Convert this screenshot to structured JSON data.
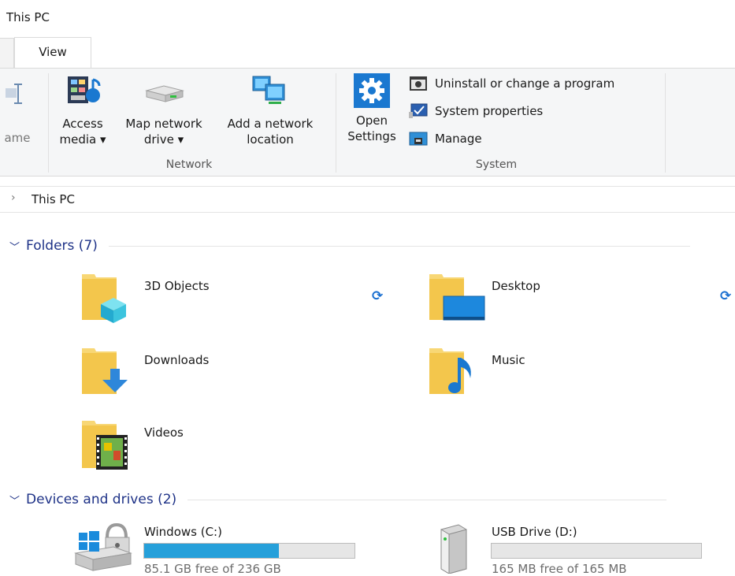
{
  "window": {
    "title": "This PC"
  },
  "tabs": [
    {
      "label": "View"
    }
  ],
  "ribbon": {
    "partial_label": "ame",
    "network": {
      "group_label": "Network",
      "buttons": [
        {
          "line1": "Access",
          "line2": "media ▾"
        },
        {
          "line1": "Map network",
          "line2": "drive ▾"
        },
        {
          "line1": "Add a network",
          "line2": "location"
        }
      ]
    },
    "system": {
      "group_label": "System",
      "open_settings": {
        "line1": "Open",
        "line2": "Settings"
      },
      "items": [
        {
          "label": "Uninstall or change a program",
          "icon": "uninstall-icon"
        },
        {
          "label": "System properties",
          "icon": "system-properties-icon"
        },
        {
          "label": "Manage",
          "icon": "manage-icon"
        }
      ]
    }
  },
  "address_bar": {
    "chevron": "›",
    "crumb": "This PC"
  },
  "folders_section": {
    "label": "Folders (7)",
    "items": [
      {
        "name": "3D Objects",
        "icon": "3d-objects-folder-icon",
        "synced": true
      },
      {
        "name": "Desktop",
        "icon": "desktop-folder-icon",
        "synced": true
      },
      {
        "name": "Downloads",
        "icon": "downloads-folder-icon",
        "synced": false
      },
      {
        "name": "Music",
        "icon": "music-folder-icon",
        "synced": false
      },
      {
        "name": "Videos",
        "icon": "videos-folder-icon",
        "synced": false
      }
    ]
  },
  "drives_section": {
    "label": "Devices and drives (2)",
    "drives": [
      {
        "name": "Windows (C:)",
        "free_text": "85.1 GB free of 236 GB",
        "used_fraction": 0.64,
        "icon": "windows-drive-icon"
      },
      {
        "name": "USB Drive (D:)",
        "free_text": "165 MB free of 165 MB",
        "used_fraction": 0.0,
        "icon": "usb-drive-icon"
      }
    ]
  },
  "colors": {
    "accent": "#1e3287",
    "drive_fill": "#26a0da",
    "sync": "#1a6fd0",
    "folder": "#f8d775"
  }
}
